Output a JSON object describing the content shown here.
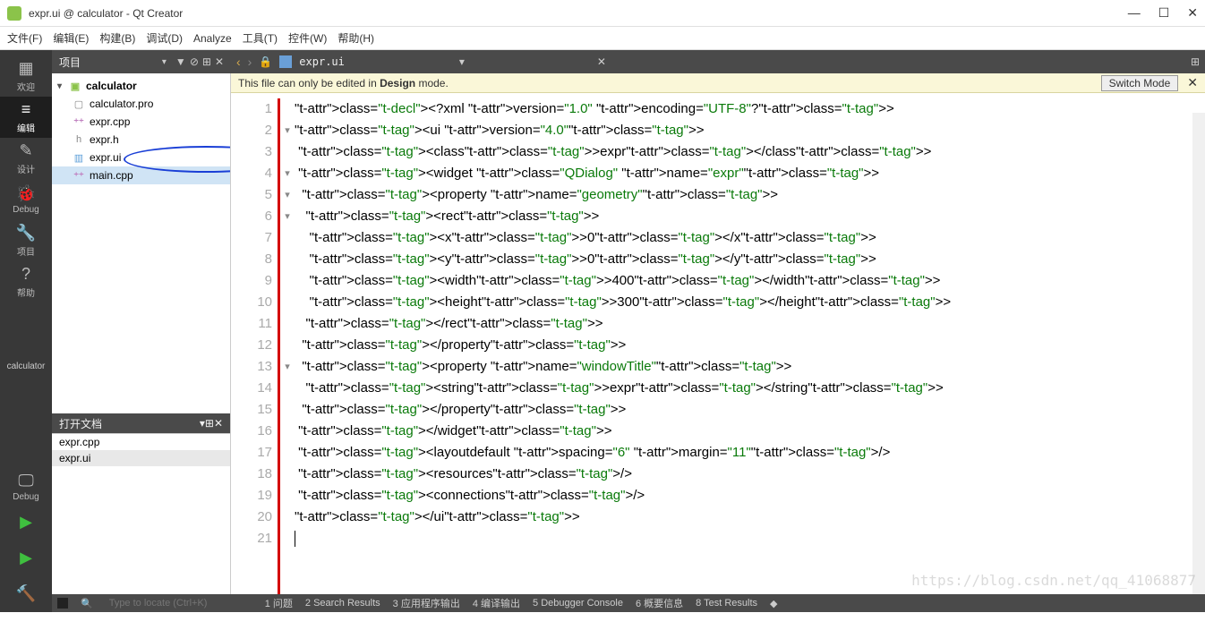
{
  "window": {
    "title": "expr.ui @ calculator - Qt Creator"
  },
  "menu": [
    "文件(F)",
    "编辑(E)",
    "构建(B)",
    "调试(D)",
    "Analyze",
    "工具(T)",
    "控件(W)",
    "帮助(H)"
  ],
  "sidebar": {
    "items": [
      {
        "icon": "▦",
        "label": "欢迎"
      },
      {
        "icon": "≡",
        "label": "编辑"
      },
      {
        "icon": "✎",
        "label": "设计"
      },
      {
        "icon": "🐞",
        "label": "Debug"
      },
      {
        "icon": "🔧",
        "label": "项目"
      },
      {
        "icon": "?",
        "label": "帮助"
      }
    ],
    "calc": "calculator",
    "bottom": [
      {
        "icon": "🖵",
        "label": "Debug"
      },
      {
        "icon": "▶",
        "label": "",
        "color": "#3fbf3f"
      },
      {
        "icon": "▶",
        "label": "",
        "color": "#3fbf3f",
        "bug": true
      },
      {
        "icon": "🔨",
        "label": ""
      }
    ]
  },
  "project_panel": {
    "title": "项目"
  },
  "tree": {
    "root": "calculator",
    "items": [
      {
        "name": "calculator.pro",
        "cls": "pro"
      },
      {
        "name": "expr.cpp",
        "cls": "cpp"
      },
      {
        "name": "expr.h",
        "cls": "h"
      },
      {
        "name": "expr.ui",
        "cls": "ui",
        "circled": true
      },
      {
        "name": "main.cpp",
        "cls": "cpp",
        "sel": true
      }
    ]
  },
  "docs": {
    "title": "打开文档",
    "items": [
      "expr.cpp",
      "expr.ui"
    ]
  },
  "tab": {
    "file": "expr.ui"
  },
  "banner": {
    "text": "This file can only be edited in ",
    "bold": "Design",
    "text2": " mode.",
    "switch": "Switch Mode"
  },
  "code": {
    "lines": [
      "<?xml version=\"1.0\" encoding=\"UTF-8\"?>",
      "<ui version=\"4.0\">",
      " <class>expr</class>",
      " <widget class=\"QDialog\" name=\"expr\">",
      "  <property name=\"geometry\">",
      "   <rect>",
      "    <x>0</x>",
      "    <y>0</y>",
      "    <width>400</width>",
      "    <height>300</height>",
      "   </rect>",
      "  </property>",
      "  <property name=\"windowTitle\">",
      "   <string>expr</string>",
      "  </property>",
      " </widget>",
      " <layoutdefault spacing=\"6\" margin=\"11\"/>",
      " <resources/>",
      " <connections/>",
      "</ui>",
      ""
    ],
    "folds": [
      null,
      "▾",
      null,
      "▾",
      "▾",
      "▾",
      null,
      null,
      null,
      null,
      null,
      null,
      "▾",
      null,
      null,
      null,
      null,
      null,
      null,
      null,
      null
    ]
  },
  "status": {
    "placeholder": "Type to locate (Ctrl+K)",
    "items": [
      "1  问题",
      "2  Search Results",
      "3  应用程序输出",
      "4  编译输出",
      "5  Debugger Console",
      "6  概要信息",
      "8  Test Results"
    ]
  },
  "watermark": "https://blog.csdn.net/qq_41068877"
}
